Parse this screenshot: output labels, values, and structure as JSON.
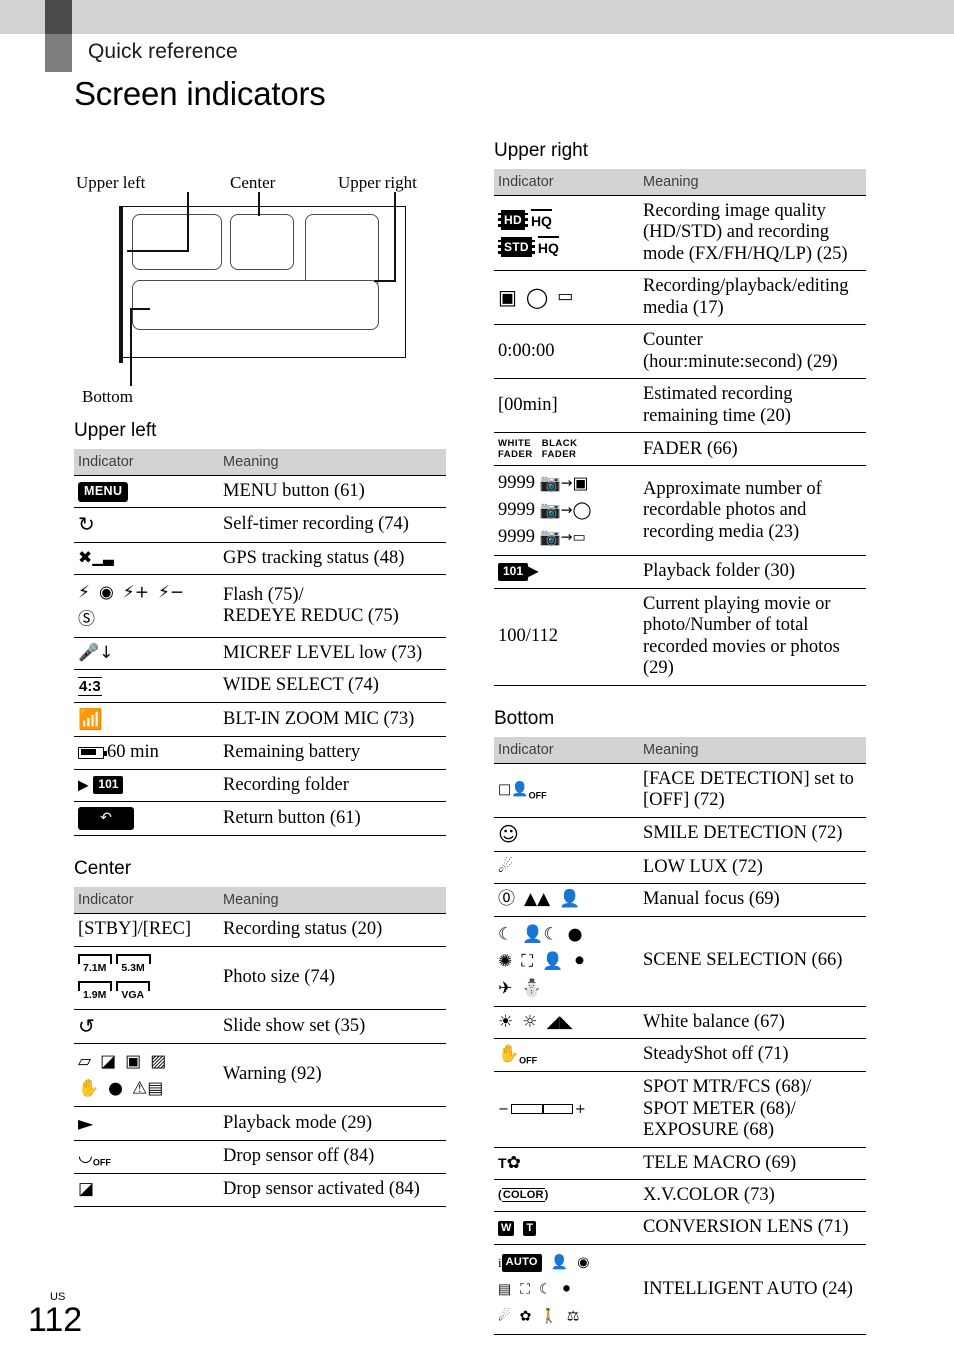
{
  "header": {
    "chapter": "Quick reference",
    "title": "Screen indicators"
  },
  "diagram": {
    "labels": {
      "upper_left": "Upper left",
      "center": "Center",
      "upper_right": "Upper right",
      "bottom": "Bottom"
    }
  },
  "table_columns": {
    "indicator": "Indicator",
    "meaning": "Meaning"
  },
  "sections": {
    "upper_left": {
      "heading": "Upper left",
      "rows": [
        {
          "indicator_text": "MENU",
          "meaning": "MENU button (61)"
        },
        {
          "indicator_text": "",
          "meaning": "Self-timer recording (74)"
        },
        {
          "indicator_text": "",
          "meaning": "GPS tracking status (48)"
        },
        {
          "indicator_text": "",
          "meaning": "Flash (75)/\nREDEYE REDUC (75)"
        },
        {
          "indicator_text": "",
          "meaning": "MICREF LEVEL low (73)"
        },
        {
          "indicator_text": "4:3",
          "meaning": "WIDE SELECT (74)"
        },
        {
          "indicator_text": "",
          "meaning": "BLT-IN ZOOM MIC (73)"
        },
        {
          "indicator_text": "60 min",
          "meaning": "Remaining battery"
        },
        {
          "indicator_text": "101",
          "meaning": "Recording folder"
        },
        {
          "indicator_text": "",
          "meaning": "Return button (61)"
        }
      ]
    },
    "center": {
      "heading": "Center",
      "rows": [
        {
          "indicator_text": "[STBY]/[REC]",
          "meaning": "Recording status (20)"
        },
        {
          "indicator_text": "7.1M 5.3M 1.9M VGA",
          "meaning": "Photo size (74)"
        },
        {
          "indicator_text": "",
          "meaning": "Slide show set (35)"
        },
        {
          "indicator_text": "",
          "meaning": "Warning (92)"
        },
        {
          "indicator_text": "",
          "meaning": "Playback mode (29)"
        },
        {
          "indicator_text": "",
          "meaning": "Drop sensor off (84)"
        },
        {
          "indicator_text": "",
          "meaning": "Drop sensor activated (84)"
        }
      ]
    },
    "upper_right": {
      "heading": "Upper right",
      "rows": [
        {
          "indicator_text": "HD HQ / STD HQ",
          "meaning": "Recording image quality (HD/STD) and recording mode (FX/FH/HQ/LP) (25)"
        },
        {
          "indicator_text": "",
          "meaning": "Recording/playback/editing media (17)"
        },
        {
          "indicator_text": "0:00:00",
          "meaning": "Counter (hour:minute:second) (29)"
        },
        {
          "indicator_text": "[00min]",
          "meaning": "Estimated recording remaining time (20)"
        },
        {
          "indicator_text": "WHITE FADER BLACK FADER",
          "meaning": "FADER (66)"
        },
        {
          "indicator_text": "9999",
          "meaning": "Approximate number of recordable photos and recording media (23)"
        },
        {
          "indicator_text": "101",
          "meaning": "Playback folder (30)"
        },
        {
          "indicator_text": "100/112",
          "meaning": "Current playing movie or photo/Number of total recorded movies or photos (29)"
        }
      ]
    },
    "bottom": {
      "heading": "Bottom",
      "rows": [
        {
          "indicator_text": "",
          "meaning": "[FACE DETECTION] set to [OFF] (72)"
        },
        {
          "indicator_text": "",
          "meaning": "SMILE DETECTION (72)"
        },
        {
          "indicator_text": "",
          "meaning": "LOW LUX (72)"
        },
        {
          "indicator_text": "",
          "meaning": "Manual focus (69)"
        },
        {
          "indicator_text": "",
          "meaning": "SCENE SELECTION (66)"
        },
        {
          "indicator_text": "",
          "meaning": "White balance (67)"
        },
        {
          "indicator_text": "",
          "meaning": "SteadyShot off (71)"
        },
        {
          "indicator_text": "",
          "meaning": "SPOT MTR/FCS (68)/\nSPOT METER (68)/\nEXPOSURE (68)"
        },
        {
          "indicator_text": "T",
          "meaning": "TELE MACRO (69)"
        },
        {
          "indicator_text": "COLOR",
          "meaning": "X.V.COLOR (73)"
        },
        {
          "indicator_text": "W T",
          "meaning": "CONVERSION LENS (71)"
        },
        {
          "indicator_text": "AUTO",
          "meaning": "INTELLIGENT AUTO (24)"
        }
      ]
    }
  },
  "labels": {
    "menu_badge": "MENU",
    "ratio_43": "4:3",
    "battery_time": "60 min",
    "folder_101": "101",
    "stby_rec": "[STBY]/[REC]",
    "psize_71": "7.1M",
    "psize_53": "5.3M",
    "psize_19": "1.9M",
    "psize_vga": "VGA",
    "hd": "HD",
    "std": "STD",
    "hq": "HQ",
    "counter": "0:00:00",
    "remaining": "[00min]",
    "fader_white": "WHITE",
    "fader_white2": "FADER",
    "fader_black": "BLACK",
    "fader_black2": "FADER",
    "nine": "9999",
    "current_total": "100/112",
    "tele_t": "T",
    "xvcolor": "COLOR",
    "conv_w": "W",
    "conv_t": "T",
    "intelligent_auto": "AUTO",
    "off": "OFF"
  },
  "footer": {
    "locale": "US",
    "page": "112"
  }
}
